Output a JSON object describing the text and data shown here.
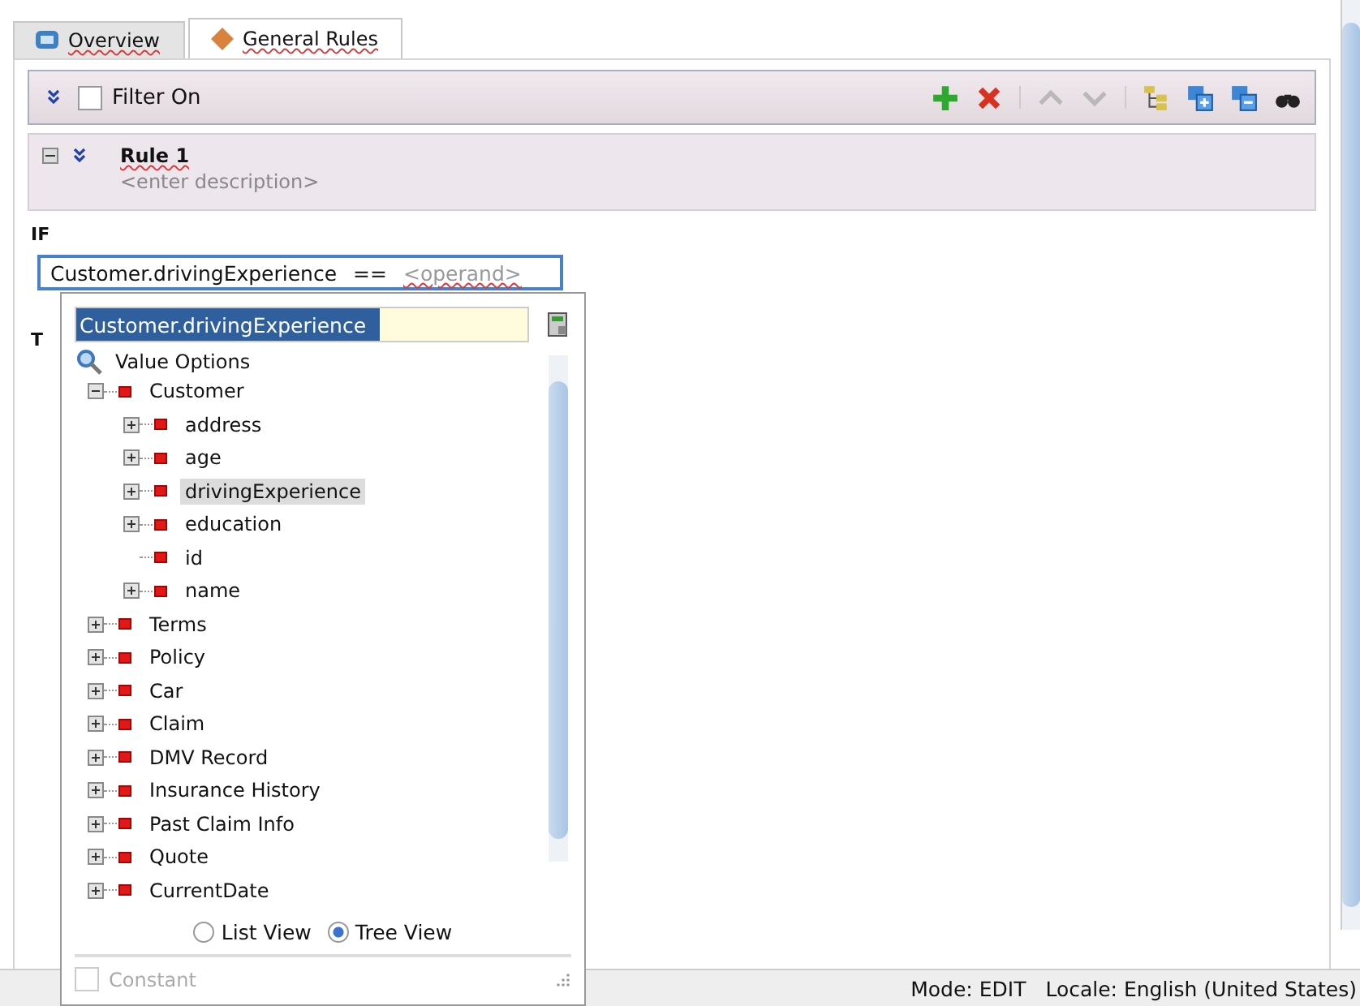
{
  "tabs": [
    {
      "label": "Overview",
      "selected": false
    },
    {
      "label": "General Rules",
      "selected": true
    }
  ],
  "filter": {
    "label": "Filter On",
    "checked": false
  },
  "rule": {
    "name": "Rule 1",
    "description": "<enter description>",
    "expanded": true
  },
  "if_label": "IF",
  "then_label_partial": "T",
  "expression": {
    "left": "Customer.drivingExperience",
    "operator": "==",
    "operand_placeholder": "<operand>"
  },
  "popup": {
    "search_value": "Customer.drivingExperience",
    "tree_header": "Value Options",
    "tree": [
      {
        "label": "Customer",
        "kind": "branch",
        "expanded": true,
        "selected": false,
        "children": [
          {
            "label": "address",
            "kind": "branch",
            "expanded": false,
            "selected": false
          },
          {
            "label": "age",
            "kind": "branch",
            "expanded": false,
            "selected": false
          },
          {
            "label": "drivingExperience",
            "kind": "branch",
            "expanded": false,
            "selected": true
          },
          {
            "label": "education",
            "kind": "branch",
            "expanded": false,
            "selected": false
          },
          {
            "label": "id",
            "kind": "leaf",
            "selected": false
          },
          {
            "label": "name",
            "kind": "branch",
            "expanded": false,
            "selected": false
          }
        ]
      },
      {
        "label": "Terms",
        "kind": "branch",
        "expanded": false,
        "selected": false
      },
      {
        "label": "Policy",
        "kind": "branch",
        "expanded": false,
        "selected": false
      },
      {
        "label": "Car",
        "kind": "branch",
        "expanded": false,
        "selected": false
      },
      {
        "label": "Claim",
        "kind": "branch",
        "expanded": false,
        "selected": false
      },
      {
        "label": "DMV Record",
        "kind": "branch",
        "expanded": false,
        "selected": false
      },
      {
        "label": "Insurance History",
        "kind": "branch",
        "expanded": false,
        "selected": false
      },
      {
        "label": "Past Claim Info",
        "kind": "branch",
        "expanded": false,
        "selected": false
      },
      {
        "label": "Quote",
        "kind": "branch",
        "expanded": false,
        "selected": false
      },
      {
        "label": "CurrentDate",
        "kind": "branch",
        "expanded": false,
        "selected": false
      }
    ],
    "views": [
      {
        "label": "List View",
        "selected": false
      },
      {
        "label": "Tree View",
        "selected": true
      }
    ],
    "constant": {
      "label": "Constant",
      "checked": false,
      "disabled": true
    }
  },
  "status_bar": {
    "mode": "Mode: EDIT",
    "locale": "Locale: English (United States)"
  }
}
